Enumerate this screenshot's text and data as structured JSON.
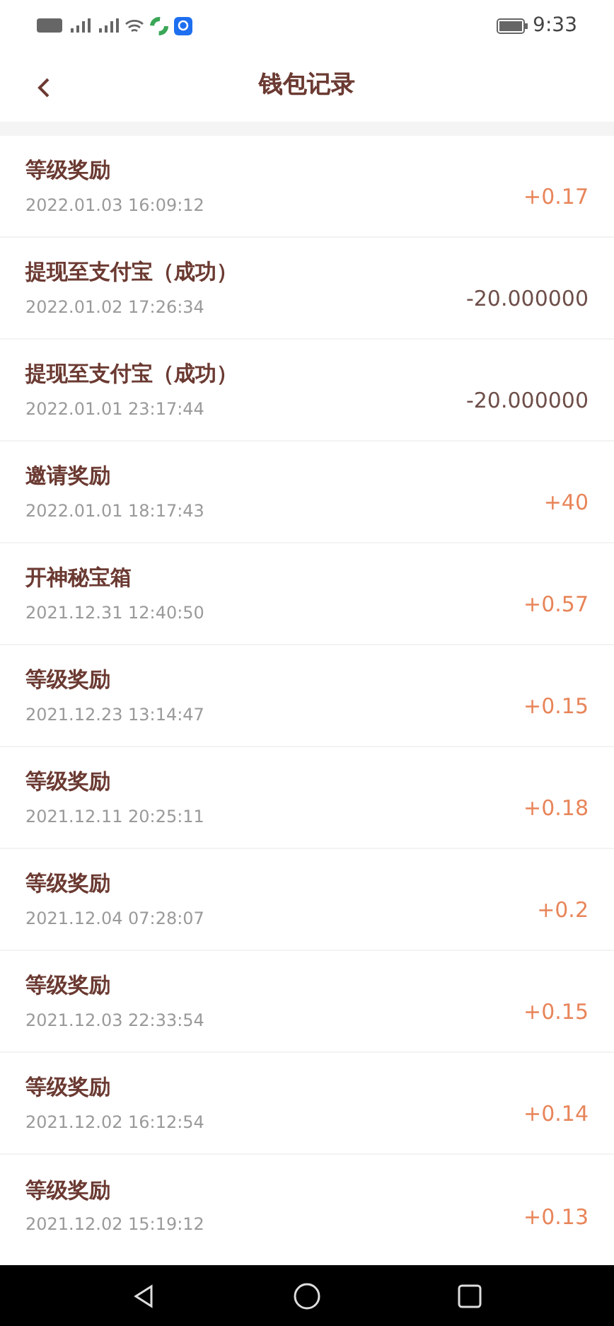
{
  "status_bar": {
    "time": "9:33"
  },
  "header": {
    "title": "钱包记录"
  },
  "records": [
    {
      "title": "等级奖励",
      "time": "2022.01.03 16:09:12",
      "amount": "+0.17",
      "kind": "income"
    },
    {
      "title": "提现至支付宝（成功）",
      "time": "2022.01.02 17:26:34",
      "amount": "-20.000000",
      "kind": "withdrawal"
    },
    {
      "title": "提现至支付宝（成功）",
      "time": "2022.01.01 23:17:44",
      "amount": "-20.000000",
      "kind": "withdrawal"
    },
    {
      "title": "邀请奖励",
      "time": "2022.01.01 18:17:43",
      "amount": "+40",
      "kind": "income"
    },
    {
      "title": "开神秘宝箱",
      "time": "2021.12.31 12:40:50",
      "amount": "+0.57",
      "kind": "income"
    },
    {
      "title": "等级奖励",
      "time": "2021.12.23 13:14:47",
      "amount": "+0.15",
      "kind": "income"
    },
    {
      "title": "等级奖励",
      "time": "2021.12.11 20:25:11",
      "amount": "+0.18",
      "kind": "income"
    },
    {
      "title": "等级奖励",
      "time": "2021.12.04 07:28:07",
      "amount": "+0.2",
      "kind": "income"
    },
    {
      "title": "等级奖励",
      "time": "2021.12.03 22:33:54",
      "amount": "+0.15",
      "kind": "income"
    },
    {
      "title": "等级奖励",
      "time": "2021.12.02 16:12:54",
      "amount": "+0.14",
      "kind": "income"
    },
    {
      "title": "等级奖励",
      "time": "2021.12.02 15:19:12",
      "amount": "+0.13",
      "kind": "income"
    }
  ]
}
